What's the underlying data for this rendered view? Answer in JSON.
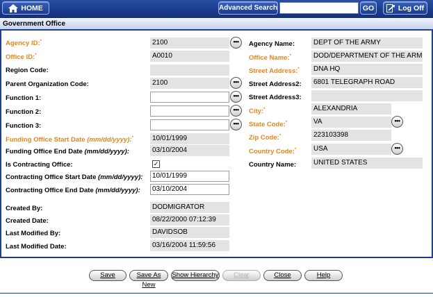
{
  "topbar": {
    "home_label": "HOME",
    "advanced_search_label": "Advanced Search",
    "search_value": "",
    "go_label": "GO",
    "logoff_label": "Log Off"
  },
  "title": "Government Office",
  "required_mark": "*",
  "labels": {
    "agency_id": "Agency ID:",
    "office_id": "Office ID:",
    "region_code": "Region Code:",
    "parent_org_code": "Parent Organization Code:",
    "function1": "Function 1:",
    "function2": "Function 2:",
    "function3": "Function 3:",
    "funding_start": "Funding Office Start Date",
    "funding_end": "Funding Office End Date",
    "is_contracting": "Is Contracting Office:",
    "contracting_start": "Contracting Office Start Date",
    "contracting_end": "Contracting Office End Date",
    "date_format": "(mm/dd/yyyy):",
    "created_by": "Created By:",
    "created_date": "Created Date:",
    "last_modified_by": "Last Modified By:",
    "last_modified_date": "Last Modified Date:",
    "agency_name": "Agency Name:",
    "office_name": "Office Name:",
    "street1": "Street Address:",
    "street2": "Street Address2:",
    "street3": "Street Address3:",
    "city": "City:",
    "state_code": "State Code:",
    "zip_code": "Zip Code:",
    "country_code": "Country Code:",
    "country_name": "Country Name:"
  },
  "values": {
    "agency_id": "2100",
    "office_id": "A0010",
    "region_code": "",
    "parent_org_code": "2100",
    "function1": "",
    "function2": "",
    "function3": "",
    "funding_start": "10/01/1999",
    "funding_end": "03/10/2004",
    "is_contracting_mark": "✓",
    "contracting_start": "10/01/1999",
    "contracting_end": "03/10/2004",
    "created_by": "DODMIGRATOR",
    "created_date": "08/22/2000 07:12:39",
    "last_modified_by": "DAVIDSOB",
    "last_modified_date": "03/16/2004 11:59:56",
    "agency_name": "DEPT OF THE ARMY",
    "office_name": "DOD/DEPARTMENT OF THE ARMY",
    "street1": "DNA HQ",
    "street2": "6801 TELEGRAPH ROAD",
    "street3": "",
    "city": "ALEXANDRIA",
    "state_code": "VA",
    "zip_code": "223103398",
    "country_code": "USA",
    "country_name": "UNITED STATES"
  },
  "lookup_glyph": "•••",
  "buttons": {
    "save": "Save",
    "save_as_new": "Save As New",
    "show_hierarchy": "Show Hierarchy",
    "clear": "Clear",
    "close": "Close",
    "help": "Help"
  },
  "colors": {
    "required_label": "#e3861b",
    "header_blue": "#1f3f8e",
    "readonly_field": "#e3e3e3"
  }
}
